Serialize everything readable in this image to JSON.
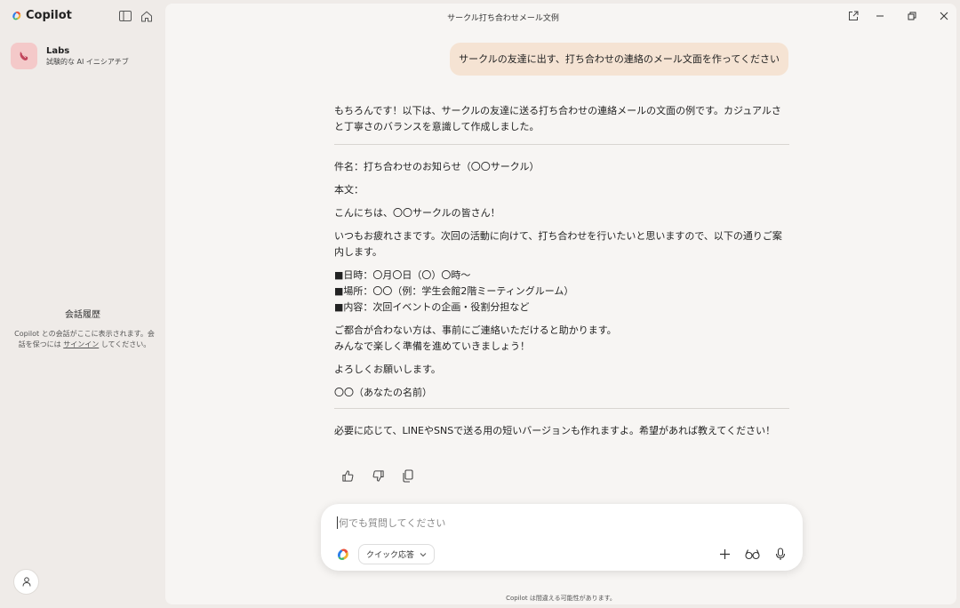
{
  "app": {
    "name": "Copilot"
  },
  "sidebar": {
    "labs_title": "Labs",
    "labs_subtitle": "試験的な AI イニシアチブ",
    "history_title": "会話履歴",
    "history_text_before": "Copilot との会話がここに表示されます。会話を保つには ",
    "history_link": "サインイン",
    "history_text_after": " してください。"
  },
  "window": {
    "title": "サークル打ち合わせメール文例"
  },
  "conversation": {
    "user_message": "サークルの友達に出す、打ち合わせの連絡のメール文面を作ってください",
    "intro": "もちろんです！以下は、サークルの友達に送る打ち合わせの連絡メールの文面の例です。カジュアルさと丁寧さのバランスを意識して作成しました。",
    "email": {
      "subject": "件名：打ち合わせのお知らせ（〇〇サークル）",
      "body_label": "本文：",
      "greeting": "こんにちは、〇〇サークルの皆さん！",
      "para1": "いつもお疲れさまです。次回の活動に向けて、打ち合わせを行いたいと思いますので、以下の通りご案内します。",
      "date": "■日時：〇月〇日（〇）〇時〜",
      "place": "■場所：〇〇（例：学生会館2階ミーティングルーム）",
      "content": "■内容：次回イベントの企画・役割分担など",
      "para2_line1": "ご都合が合わない方は、事前にご連絡いただけると助かります。",
      "para2_line2": "みんなで楽しく準備を進めていきましょう！",
      "closing": "よろしくお願いします。",
      "signature": "〇〇（あなたの名前）"
    },
    "outro": "必要に応じて、LINEやSNSで送る用の短いバージョンも作れますよ。希望があれば教えてください！"
  },
  "composer": {
    "placeholder": "何でも質問してください",
    "value": "",
    "mode_label": "クイック応答"
  },
  "footer": {
    "disclaimer": "Copilot は間違える可能性があります。"
  },
  "colors": {
    "sidebar_bg": "#efebe8",
    "main_bg": "#f7f5f3",
    "user_bubble": "#f5e3d3",
    "labs_icon_bg": "#f4c9c9"
  }
}
